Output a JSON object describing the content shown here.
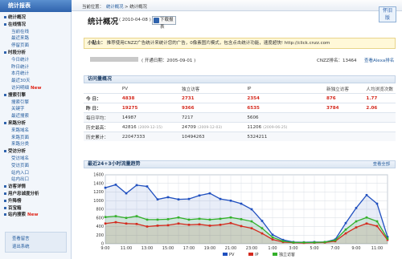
{
  "sidebar": {
    "title": "统计报表",
    "items": [
      {
        "label": "统计概况",
        "kind": "grp"
      },
      {
        "label": "在线情况",
        "kind": "grp"
      },
      {
        "label": "当前在线",
        "kind": "sub"
      },
      {
        "label": "最近来路",
        "kind": "sub"
      },
      {
        "label": "停留页面",
        "kind": "sub"
      },
      {
        "label": "时段分析",
        "kind": "grp"
      },
      {
        "label": "今日统计",
        "kind": "sub"
      },
      {
        "label": "昨日统计",
        "kind": "sub"
      },
      {
        "label": "本月统计",
        "kind": "sub"
      },
      {
        "label": "最近30天",
        "kind": "sub"
      },
      {
        "label": "访问明细",
        "kind": "sub",
        "badge": "New"
      },
      {
        "label": "搜索引擎",
        "kind": "grp"
      },
      {
        "label": "搜索引擎",
        "kind": "sub"
      },
      {
        "label": "关键字",
        "kind": "sub"
      },
      {
        "label": "最近搜索",
        "kind": "sub"
      },
      {
        "label": "来路分析",
        "kind": "grp"
      },
      {
        "label": "来路域名",
        "kind": "sub"
      },
      {
        "label": "来路页面",
        "kind": "sub"
      },
      {
        "label": "来路分类",
        "kind": "sub"
      },
      {
        "label": "受访分析",
        "kind": "grp"
      },
      {
        "label": "受访域名",
        "kind": "sub"
      },
      {
        "label": "受访页面",
        "kind": "sub"
      },
      {
        "label": "站内入口",
        "kind": "sub"
      },
      {
        "label": "站内出口",
        "kind": "sub"
      },
      {
        "label": "访客详情",
        "kind": "grp"
      },
      {
        "label": "用户忠诚度分析",
        "kind": "grp"
      },
      {
        "label": "升降榜",
        "kind": "grp"
      },
      {
        "label": "百宝箱",
        "kind": "grp"
      },
      {
        "label": "站内搜索",
        "kind": "grp",
        "badge": "New"
      }
    ],
    "bottom": [
      "查看留言",
      "退出系统"
    ]
  },
  "header": {
    "breadcrumb": [
      "当前位置：",
      "统计概况",
      "> 统计概况"
    ],
    "right_tab": "怀旧版"
  },
  "page": {
    "title": "统计概况",
    "date": "( 2010-04-08 )",
    "download_label": "下载报表"
  },
  "notice": {
    "prefix": "小贴士：",
    "text": "推荐使用CNZZ广告统计来统计您的广告，0像素图片模式，包含点击统计功能，速度超快! http://click.cnzz.com"
  },
  "site": {
    "open_date": "( 开通日期：2005-09-01 )",
    "rank": "CNZZ排名：13464",
    "alexa_link": "查看Alexa排名"
  },
  "overview": {
    "title": "访问量概况",
    "view_all": "查看全部",
    "headers": [
      "",
      "PV",
      "独立访客",
      "IP",
      "新独立访客",
      "人均浏览次数"
    ],
    "rows": [
      {
        "label": "今  日：",
        "pv": "4838",
        "uv": "2731",
        "ip": "2354",
        "new": "876",
        "avg": "1.77"
      },
      {
        "label": "昨  日：",
        "pv": "19275",
        "uv": "9366",
        "ip": "6535",
        "new": "3784",
        "avg": "2.06"
      }
    ],
    "daily_avg": {
      "label": "每日平均：",
      "pv": "14987",
      "uv": "7217",
      "ip": "5606"
    },
    "history_high": {
      "label": "历史最高：",
      "pv": "42816",
      "pv_date": "(2009-12-15)",
      "uv": "24709",
      "uv_date": "(2009-12-03)",
      "ip": "11206",
      "ip_date": "(2009-06-25)"
    },
    "history_total": {
      "label": "历史累计：",
      "pv": "22047333",
      "uv": "10494263",
      "ip": "5324211"
    }
  },
  "trend": {
    "title": "最近24+3小时流量趋势",
    "view_all": "查看全部",
    "legend": [
      "PV",
      "IP",
      "独立访客"
    ]
  },
  "colors": {
    "pv": "#1f4fbf",
    "ip": "#d42a1e",
    "uv": "#33b02a",
    "accent": "#2f63ad"
  },
  "chart_data": {
    "type": "line",
    "x": [
      "9:00",
      "10:00",
      "11:00",
      "12:00",
      "13:00",
      "14:00",
      "15:00",
      "16:00",
      "17:00",
      "18:00",
      "19:00",
      "20:00",
      "21:00",
      "22:00",
      "23:00",
      "0:00",
      "1:00",
      "2:00",
      "3:00",
      "4:00",
      "5:00",
      "6:00",
      "7:00",
      "8:00",
      "9:00",
      "10:00",
      "11:00",
      "12:00"
    ],
    "xticks": [
      "9:00",
      "11:00",
      "13:00",
      "15:00",
      "17:00",
      "19:00",
      "21:00",
      "23:00",
      "1:00",
      "3:00",
      "5:00",
      "7:00",
      "9:00",
      "11:00"
    ],
    "ylim": [
      0,
      1600
    ],
    "yticks": [
      0,
      200,
      400,
      600,
      800,
      1000,
      1200,
      1400,
      1600
    ],
    "grid": true,
    "legend_position": "bottom",
    "series": [
      {
        "name": "PV",
        "values": [
          1300,
          1370,
          1170,
          1360,
          1330,
          1030,
          1080,
          1030,
          1040,
          1120,
          1170,
          1040,
          1000,
          930,
          800,
          530,
          210,
          90,
          40,
          35,
          40,
          40,
          100,
          480,
          830,
          1130,
          930,
          160
        ]
      },
      {
        "name": "IP",
        "values": [
          470,
          500,
          470,
          460,
          400,
          420,
          430,
          470,
          440,
          450,
          420,
          440,
          480,
          410,
          360,
          240,
          100,
          40,
          25,
          20,
          25,
          30,
          60,
          240,
          380,
          470,
          410,
          90
        ]
      },
      {
        "name": "独立访客",
        "values": [
          620,
          640,
          600,
          640,
          560,
          560,
          570,
          610,
          560,
          580,
          560,
          580,
          610,
          570,
          520,
          360,
          150,
          60,
          30,
          30,
          30,
          40,
          80,
          330,
          520,
          610,
          520,
          120
        ]
      }
    ]
  }
}
